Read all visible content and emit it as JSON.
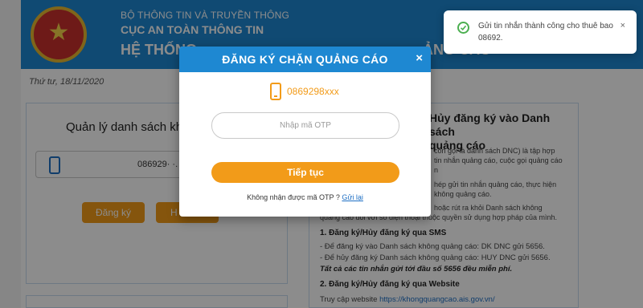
{
  "header": {
    "ministry": "BỘ THÔNG TIN VÀ TRUYỀN THÔNG",
    "agency": "CỤC AN TOÀN THÔNG TIN",
    "system": "HỆ THỐNG",
    "system_tail": "ẢNG CÁO"
  },
  "date": "Thứ tư, 18/11/2020",
  "left": {
    "title": "Quản lý danh sách khô",
    "phone": "086929· ·.",
    "register_label": "Đăng ký",
    "cancel_label": "H"
  },
  "right": {
    "title_1": "Hủy đăng ký vào Danh sách",
    "title_2": "quảng cáo",
    "para_lines": [
      "còn gọi là danh sách DNC) là tập hợp",
      "tin nhắn quảng cáo, cuộc gọi quảng cáo",
      "n",
      "hép gửi tin nhắn quảng cáo, thực hiện",
      "không quảng cáo.",
      "hoặc rút ra khỏi Danh sách không",
      "quảng cáo đối với số điện thoại thuộc quyền sử dụng hợp pháp của mình."
    ],
    "sms_head": "1. Đăng ký/Hủy đăng ký qua SMS",
    "sms_line_1": "- Để đăng ký vào Danh sách không quảng cáo: DK DNC gửi 5656.",
    "sms_line_2": "- Để hủy đăng ký Danh sách không quảng cáo: HUY DNC gửi 5656.",
    "sms_note": "Tất cả các tin nhắn gửi tới đầu số 5656 đều miễn phí.",
    "web_head": "2. Đăng ký/Hủy đăng ký qua Website",
    "web_prefix": "Truy cập website",
    "web_link": "https://khongquangcao.ais.gov.vn/"
  },
  "modal": {
    "title": "ĐĂNG KÝ CHẶN QUẢNG CÁO",
    "close": "×",
    "phone": "0869298xxx",
    "otp_placeholder": "Nhập mã OTP",
    "otp_value": "",
    "continue_label": "Tiếp tục",
    "resend_text": "Không nhận được mã OTP ?",
    "resend_link": "Gửi lại"
  },
  "toast": {
    "message": "Gửi tin nhắn thành công cho thuê bao 08692.",
    "close": "×"
  },
  "colors": {
    "primary_blue": "#1e88d2",
    "accent_orange": "#f29b19",
    "success_green": "#4caf50"
  },
  "icons": {
    "modal_phone": "smartphone-icon",
    "toast_status": "check-circle-icon",
    "emblem": "national-emblem"
  }
}
